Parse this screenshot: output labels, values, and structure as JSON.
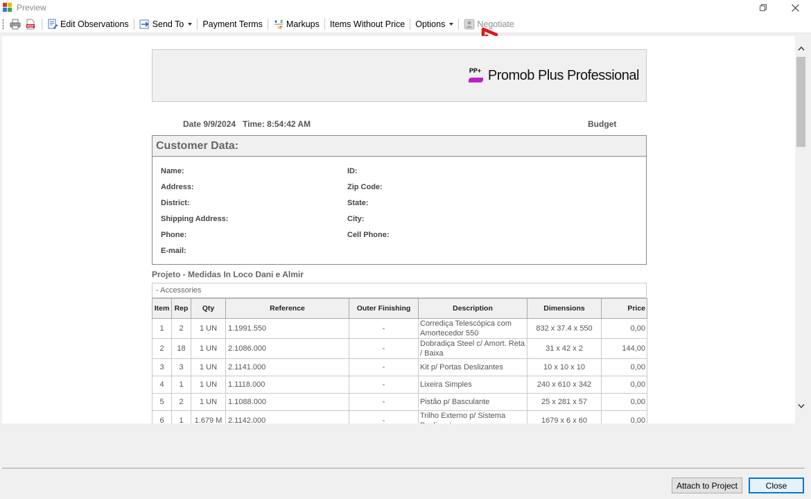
{
  "window": {
    "title": "Preview"
  },
  "toolbar": {
    "edit_observations": "Edit Observations",
    "send_to": "Send To",
    "payment_terms": "Payment Terms",
    "markups": "Markups",
    "items_without_price": "Items Without Price",
    "options": "Options",
    "negotiate": "Negotiate"
  },
  "brand": {
    "name": "Promob Plus Professional",
    "logo_text": "PP+"
  },
  "report": {
    "date": "Date 9/9/2024   Time: 8:54:42 AM",
    "doc_type": "Budget",
    "customer_title": "Customer Data:",
    "customer_fields": {
      "name": "Name:",
      "id": "ID:",
      "address": "Address:",
      "zip": "Zip Code:",
      "district": "District:",
      "state": "State:",
      "shipping": "Shipping Address:",
      "city": "City:",
      "phone": "Phone:",
      "cell": "Cell Phone:",
      "email": "E-mail:"
    },
    "project_title": "Projeto - Medidas In Loco Dani e Almir",
    "section_label": "- Accessories",
    "columns": [
      "Item",
      "Rep",
      "Qty",
      "Reference",
      "Outer Finishing",
      "Description",
      "Dimensions",
      "Price"
    ],
    "rows": [
      {
        "item": "1",
        "rep": "2",
        "qty": "1 UN",
        "ref": "1.1991.550",
        "finish": "-",
        "desc": "Corrediça Telescópica com Amortecedor 550",
        "dims": "832 x 37.4 x 550",
        "price": "0,00"
      },
      {
        "item": "2",
        "rep": "18",
        "qty": "1 UN",
        "ref": "2.1086.000",
        "finish": "-",
        "desc": "Dobradiça Steel c/ Amort. Reta / Baixa",
        "dims": "31 x 42 x 2",
        "price": "144,00"
      },
      {
        "item": "3",
        "rep": "3",
        "qty": "1 UN",
        "ref": "2.1141.000",
        "finish": "-",
        "desc": "Kit p/ Portas Deslizantes",
        "dims": "10 x 10 x 10",
        "price": "0,00"
      },
      {
        "item": "4",
        "rep": "1",
        "qty": "1 UN",
        "ref": "1.1118.000",
        "finish": "-",
        "desc": "Lixeira Simples",
        "dims": "240 x 610 x 342",
        "price": "0,00"
      },
      {
        "item": "5",
        "rep": "2",
        "qty": "1 UN",
        "ref": "1.1088.000",
        "finish": "-",
        "desc": "Pistão p/ Basculante",
        "dims": "25 x 281 x 57",
        "price": "0,00"
      },
      {
        "item": "6",
        "rep": "1",
        "qty": "1.679 M",
        "ref": "2.1142.000",
        "finish": "-",
        "desc": "Trilho Externo p/ Sistema Deslizante",
        "dims": "1679 x 6 x 60",
        "price": "0,00"
      }
    ]
  },
  "footer": {
    "attach": "Attach to Project",
    "close": "Close"
  },
  "colors": {
    "accent": "#0078d7",
    "brand": "#c01ec4",
    "annotation": "#e0161b"
  }
}
